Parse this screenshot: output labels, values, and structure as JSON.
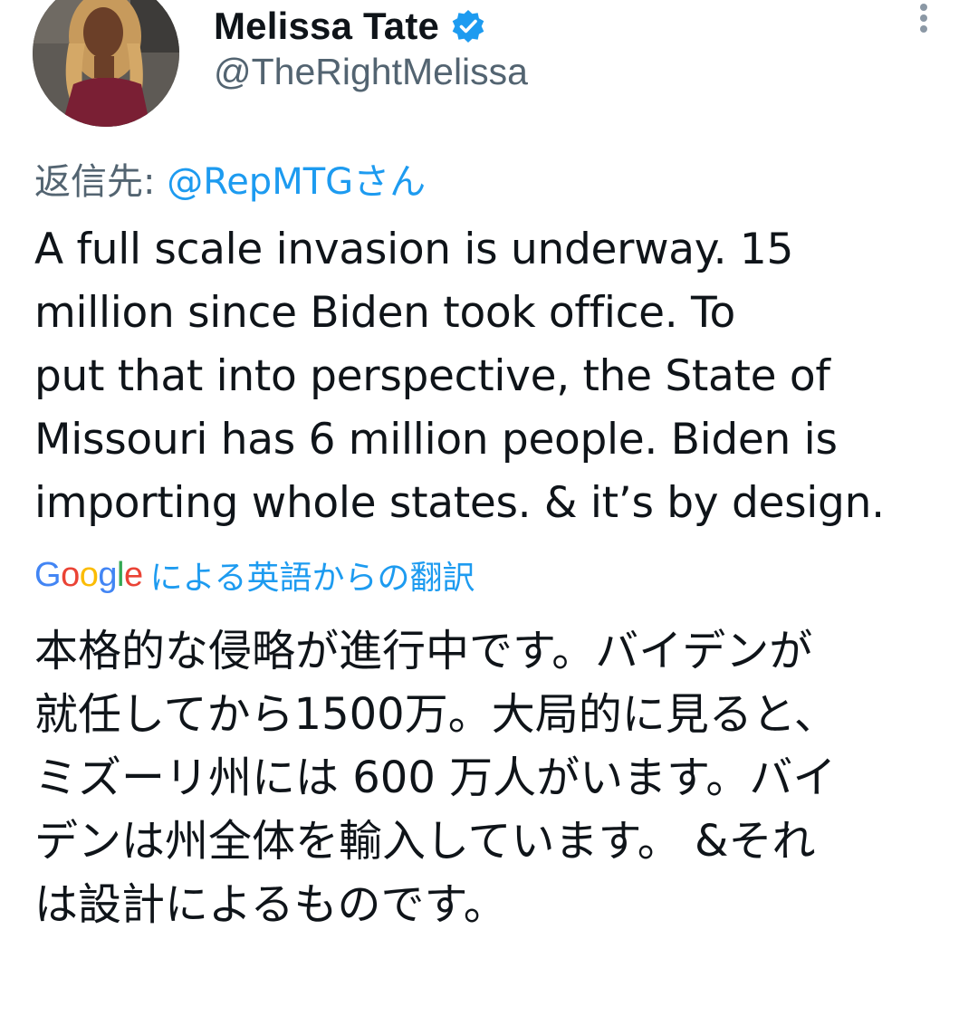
{
  "author": {
    "display_name": "Melissa Tate",
    "handle": "@TheRightMelissa",
    "verified": true
  },
  "reply": {
    "prefix": "返信先: ",
    "target": "@RepMTGさん"
  },
  "tweet": {
    "lines": [
      "A full scale invasion is underway. 15",
      "million since Biden took office. To",
      "put that into perspective, the State of",
      "Missouri has 6 million people. Biden is",
      "importing whole states. & it’s by design."
    ]
  },
  "translation": {
    "provider": "Google",
    "label": "による英語からの翻訳",
    "lines": [
      "本格的な侵略が進行中です。バイデンが",
      "就任してから1500万。大局的に見ると、",
      "ミズーリ州には 600 万人がいます。バイ",
      "デンは州全体を輸入しています。 &それ",
      "は設計によるものです。"
    ]
  },
  "icons": {
    "verified": "verified-badge-icon",
    "more": "more-vertical-icon"
  },
  "colors": {
    "link": "#1d9bf0",
    "secondary_text": "#536471",
    "primary_text": "#0f1419"
  }
}
